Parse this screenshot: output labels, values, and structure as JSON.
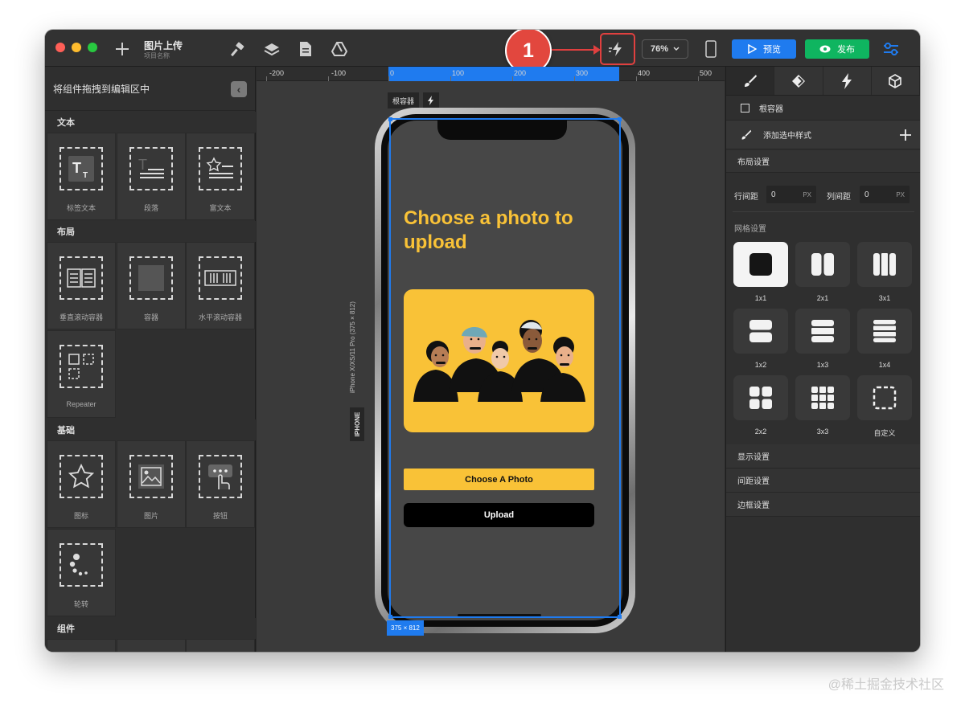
{
  "toolbar": {
    "project_title": "图片上传",
    "project_subtitle": "项目名称",
    "zoom": "76%",
    "preview_label": "预览",
    "publish_label": "发布",
    "callout_number": "1",
    "colors": {
      "preview": "#1f7bef",
      "publish": "#0fb560",
      "callout": "#e2473e"
    }
  },
  "left_panel": {
    "header": "将组件拖拽到编辑区中",
    "sections": {
      "text": {
        "title": "文本",
        "items": [
          "标签文本",
          "段落",
          "富文本"
        ]
      },
      "layout": {
        "title": "布局",
        "items": [
          "垂直滚动容器",
          "容器",
          "水平滚动容器",
          "Repeater"
        ]
      },
      "basic": {
        "title": "基础",
        "items": [
          "图标",
          "图片",
          "按钮",
          "轮转"
        ]
      },
      "components": {
        "title": "组件"
      }
    }
  },
  "canvas": {
    "ruler": [
      "-200",
      "-100",
      "0",
      "100",
      "200",
      "300",
      "400",
      "500"
    ],
    "device_tag": "根容器",
    "device_name": "iPhone X/XS/11 Pro (375 × 812)",
    "device_type": "IPHONE",
    "size_tag": "375 × 812",
    "app": {
      "title": "Choose a photo to upload",
      "choose_button": "Choose A Photo",
      "upload_button": "Upload",
      "accent": "#f9c237",
      "screen_bg": "#474747"
    }
  },
  "right_panel": {
    "root_label": "根容器",
    "add_style": "添加选中样式",
    "layout_section": "布局设置",
    "row_gap_label": "行间距",
    "row_gap_value": "0",
    "col_gap_label": "列间距",
    "col_gap_value": "0",
    "unit": "PX",
    "grid_section": "网格设置",
    "grids": [
      "1x1",
      "2x1",
      "3x1",
      "1x2",
      "1x3",
      "1x4",
      "2x2",
      "3x3",
      "自定义"
    ],
    "selected_grid": "1x1",
    "display_section": "显示设置",
    "spacing_section": "间距设置",
    "border_section": "边框设置"
  },
  "watermark": "@稀土掘金技术社区"
}
